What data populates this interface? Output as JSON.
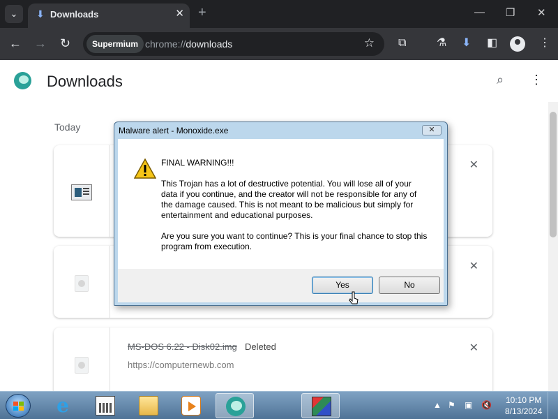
{
  "browser": {
    "tab": {
      "title": "Downloads",
      "close": "✕"
    },
    "new_tab": "+",
    "window_controls": {
      "minimize": "—",
      "restore": "❐",
      "close": "✕"
    },
    "omnibox": {
      "site_chip": "Supermium",
      "url_prefix": "chrome://",
      "url_path": "downloads"
    }
  },
  "page": {
    "title": "Downloads",
    "section": "Today",
    "items": [
      {
        "name": "",
        "status": "",
        "url": ""
      },
      {
        "name": "",
        "status": "",
        "url": ""
      },
      {
        "name": "MS-DOS 6.22 - Disk02.img",
        "status": "Deleted",
        "url": "https://computernewb.com"
      }
    ],
    "close_symbol": "✕"
  },
  "dialog": {
    "title": "Malware alert - Monoxide.exe",
    "close_symbol": "✕",
    "heading": "FINAL WARNING!!!",
    "paragraph1": "This Trojan has a lot of destructive potential. You will lose all of your data if you continue, and the creator will not be responsible for any of the damage caused. This is not meant to be malicious but simply for entertainment and educational purposes.",
    "paragraph2": "Are you sure you want to continue? This is your final chance to stop this program from execution.",
    "buttons": {
      "yes": "Yes",
      "no": "No"
    }
  },
  "taskbar": {
    "clock": {
      "time": "10:10 PM",
      "date": "8/13/2024"
    }
  },
  "colors": {
    "chrome_dark": "#202124",
    "chrome_toolbar": "#35363a",
    "dialog_frame": "#bcd7ec",
    "taskbar": "#5f83a8"
  },
  "icons": [
    "chevron-down-icon",
    "download-icon",
    "back-arrow-icon",
    "forward-arrow-icon",
    "reload-icon",
    "star-icon",
    "extensions-icon",
    "labs-icon",
    "download-toolbar-icon",
    "sidepanel-icon",
    "profile-icon",
    "more-icon",
    "search-icon",
    "warning-icon",
    "windows-start-icon",
    "internet-explorer-icon",
    "calculator-icon",
    "folder-icon",
    "media-player-icon",
    "supermium-icon",
    "trojan-app-icon"
  ]
}
